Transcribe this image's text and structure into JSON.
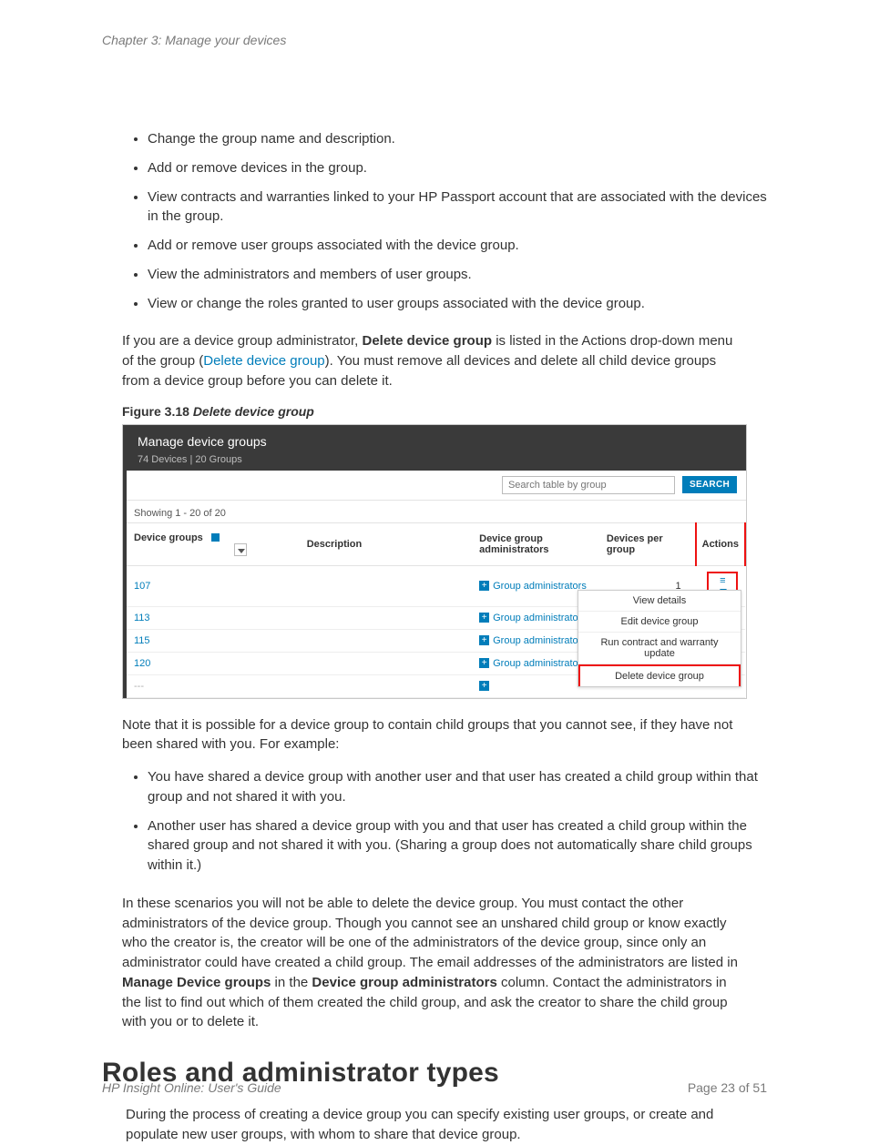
{
  "chapter_header": "Chapter 3: Manage your devices",
  "bullets_top": [
    "Change the group name and description.",
    "Add or remove devices in the group.",
    "View contracts and warranties linked to your HP Passport account that are associated with the devices in the group.",
    "Add or remove user groups associated with the device group.",
    "View the administrators and members of user groups.",
    "View or change the roles granted to user groups associated with the device group."
  ],
  "para_admin_pre": "If you are a device group administrator, ",
  "para_admin_bold": "Delete device group",
  "para_admin_mid": " is listed in the Actions drop-down menu of the group (",
  "para_admin_link": "Delete device group",
  "para_admin_post": "). You must remove all devices and delete all child device groups from a device group before you can delete it.",
  "figure_label": "Figure 3.18 ",
  "figure_title": "Delete device group",
  "shot": {
    "title": "Manage device groups",
    "subtitle": "74 Devices | 20 Groups",
    "search_placeholder": "Search table by group",
    "search_btn": "SEARCH",
    "showing": "Showing 1 - 20 of 20",
    "headers": {
      "c1": "Device groups",
      "c2": "Description",
      "c3": "Device group administrators",
      "c4": "Devices per group",
      "c5": "Actions"
    },
    "ga_label": "Group administrators",
    "rows": [
      {
        "id": "107",
        "dpg": "1"
      },
      {
        "id": "113",
        "dpg": ""
      },
      {
        "id": "115",
        "dpg": ""
      },
      {
        "id": "120",
        "dpg": ""
      }
    ],
    "menu": {
      "m1": "View details",
      "m2": "Edit device group",
      "m3": "Run contract and warranty update",
      "m4": "Delete device group"
    }
  },
  "para_note": "Note that it is possible for a device group to contain child groups that you cannot see, if they have not been shared with you. For example:",
  "bullets_examples": [
    "You have shared a device group with another user and that user has created a child group within that group and not shared it with you.",
    "Another user has shared a device group with you and that user has created a child group within the shared group and not shared it with you. (Sharing a group does not automatically share child groups within it.)"
  ],
  "para_scenarios_pre": "In these scenarios you will not be able to delete the device group. You must contact the other administrators of the device group. Though you cannot see an unshared child group or know exactly who the creator is, the creator will be one of the administrators of the device group, since only an administrator could have created a child group. The email addresses of the administrators are listed in ",
  "para_scenarios_b1": "Manage Device groups",
  "para_scenarios_mid": " in the ",
  "para_scenarios_b2": "Device group administrators",
  "para_scenarios_post": " column. Contact the administrators in the list to find out which of them created the child group, and ask the creator to share the child group with you or to delete it.",
  "section_heading": "Roles and administrator types",
  "para_roles": "During the process of creating a device group you can specify existing user groups, or create and populate new user groups, with whom to share that device group.",
  "footer_left": "HP Insight Online: User's Guide",
  "footer_right": "Page 23 of 51"
}
